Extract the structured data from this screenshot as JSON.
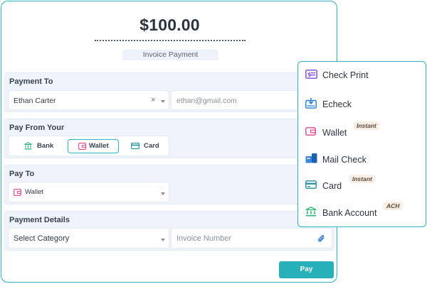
{
  "header": {
    "amount": "$100.00",
    "subtitle": "Invoice Payment"
  },
  "payment_to": {
    "title": "Payment To",
    "name_value": "Ethan Carter",
    "email_placeholder": "ethan@gmail.com"
  },
  "pay_from": {
    "title": "Pay From Your",
    "options": [
      {
        "label": "Bank",
        "selected": false
      },
      {
        "label": "Wallet",
        "selected": true
      },
      {
        "label": "Card",
        "selected": false
      }
    ]
  },
  "pay_to": {
    "title": "Pay To",
    "selected": "Wallet"
  },
  "payment_details": {
    "title": "Payment Details",
    "category_placeholder": "Select Category",
    "invoice_placeholder": "Invoice Number"
  },
  "pay_button": "Pay",
  "methods": [
    {
      "label": "Check Print",
      "icon": "check-print-icon",
      "tag": ""
    },
    {
      "label": "Echeck",
      "icon": "echeck-icon",
      "tag": ""
    },
    {
      "label": "Wallet",
      "icon": "wallet-icon",
      "tag": "Instant"
    },
    {
      "label": "Mail Check",
      "icon": "mail-check-icon",
      "tag": ""
    },
    {
      "label": "Card",
      "icon": "card-icon",
      "tag": "Instant"
    },
    {
      "label": "Bank Account",
      "icon": "bank-icon",
      "tag": "ACH"
    }
  ],
  "colors": {
    "accent": "#2fb3bd",
    "button": "#27b0b8",
    "section_bg": "#eef3fc",
    "wallet_pink": "#e0448a",
    "bank_green": "#22b573",
    "check_purple": "#7a4ad9",
    "echeck_blue": "#2a7fd4"
  }
}
